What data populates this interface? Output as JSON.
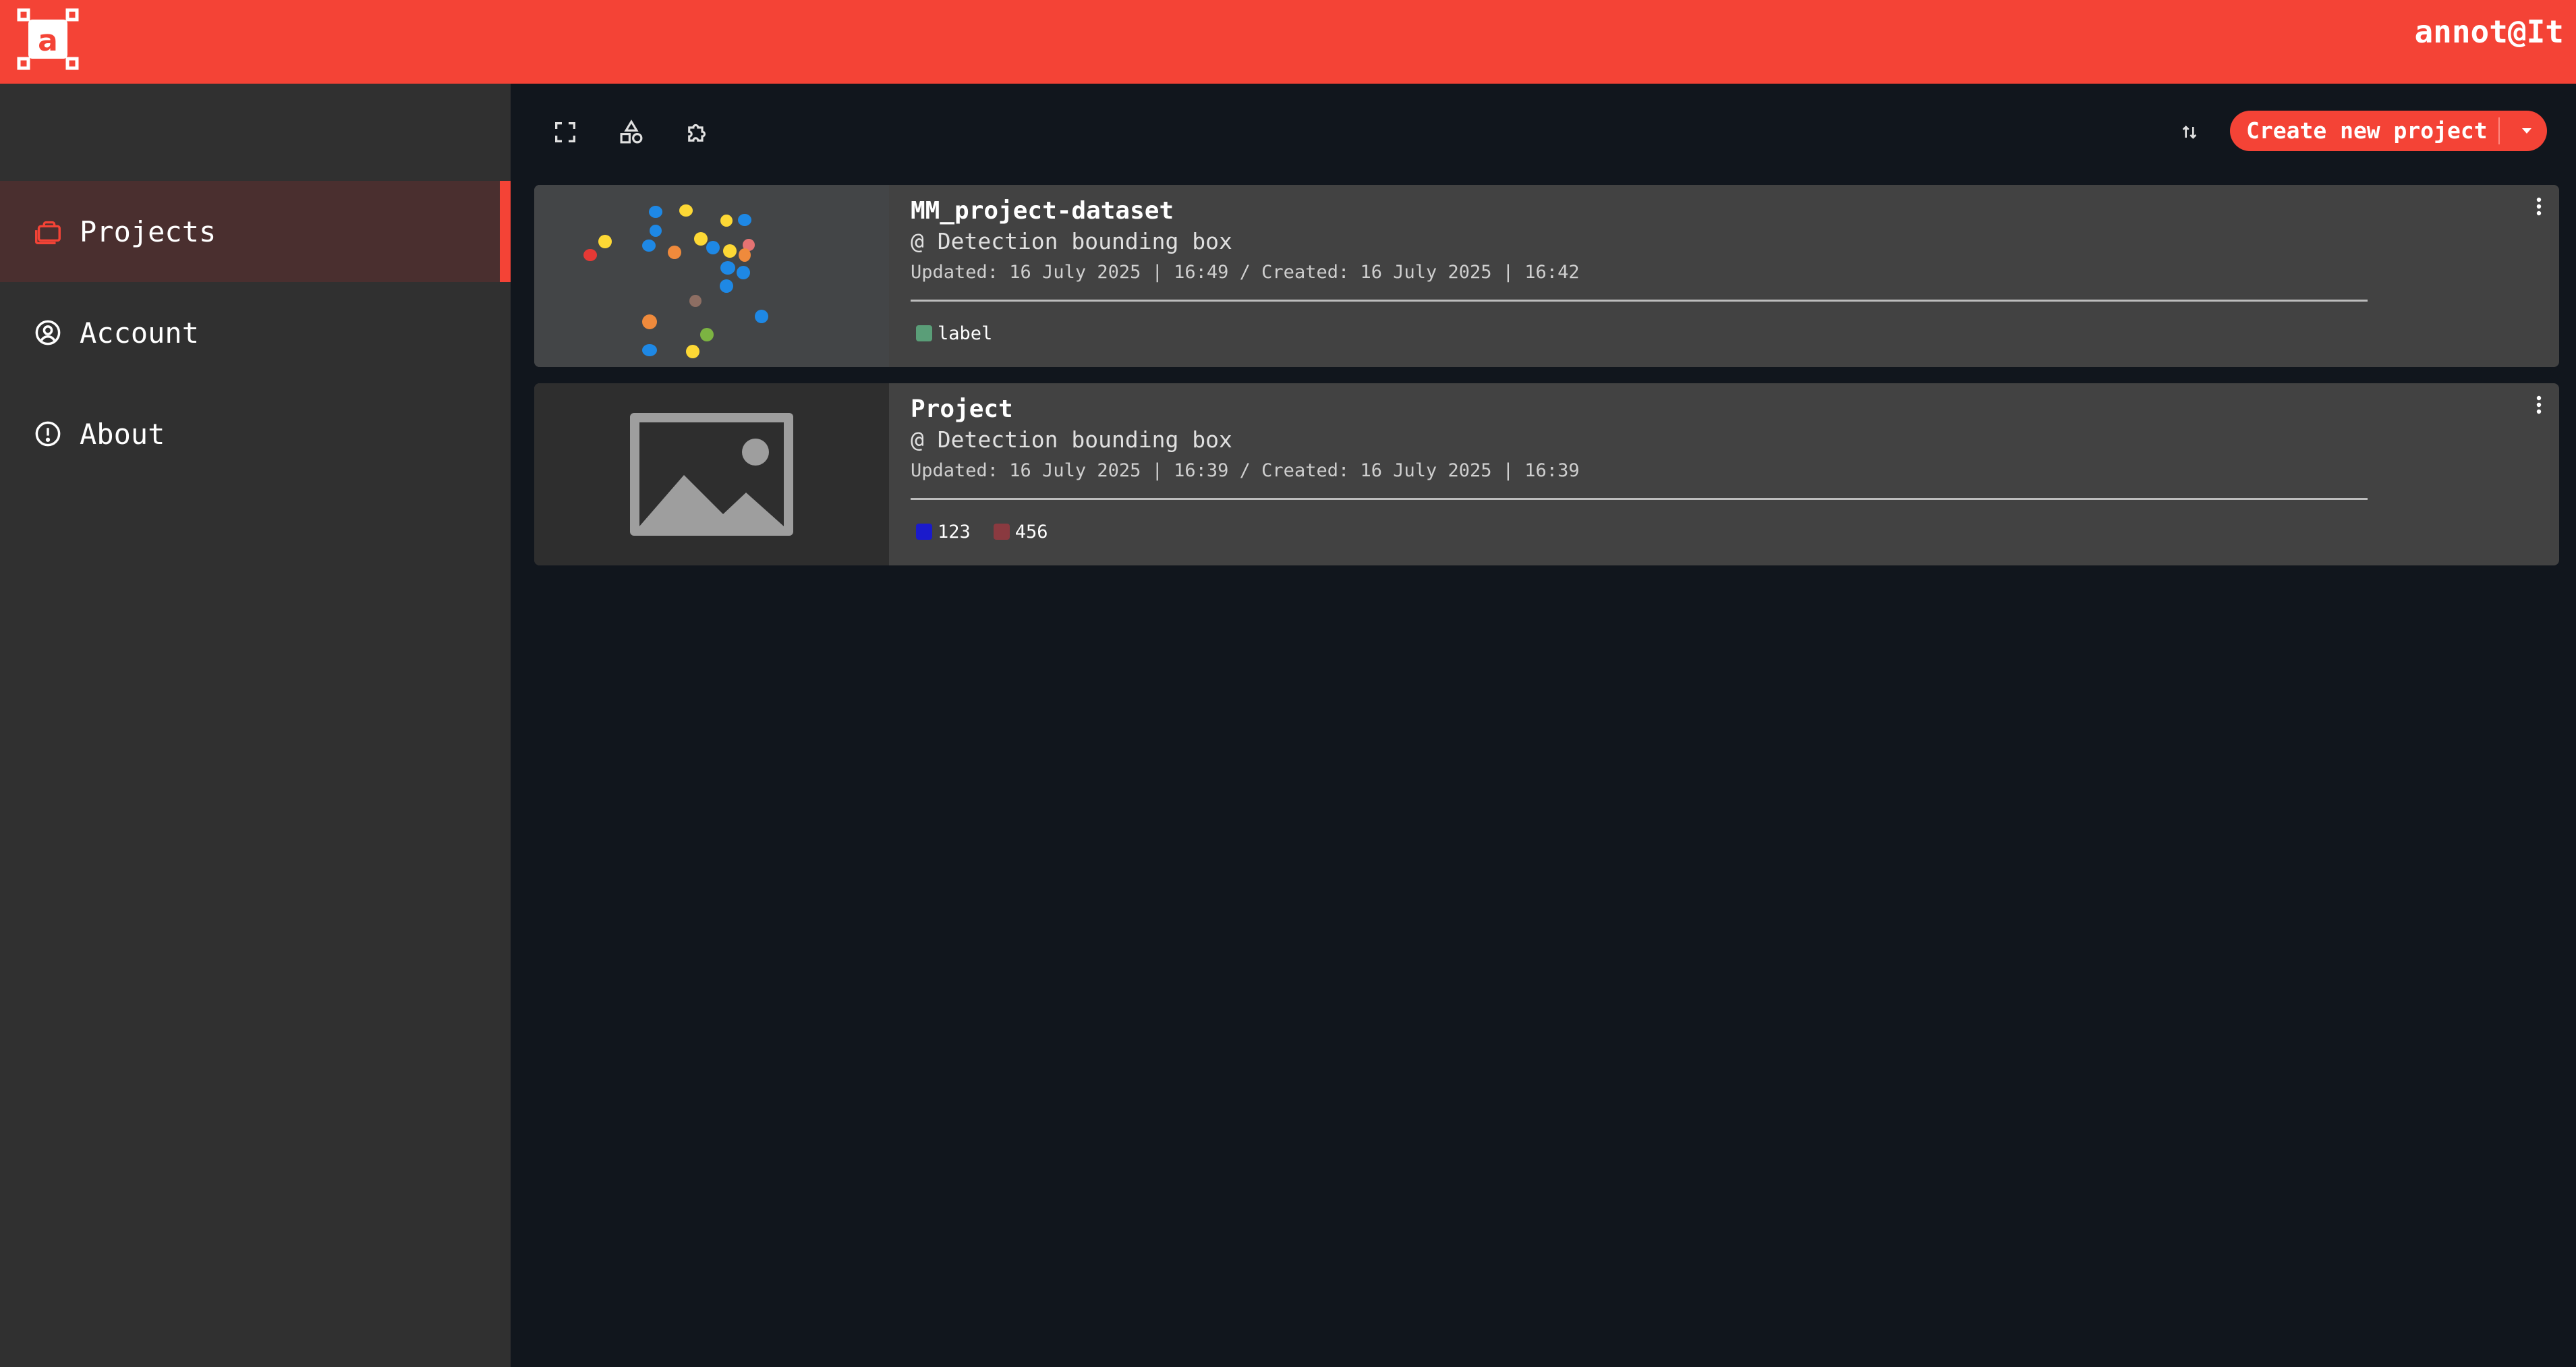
{
  "app": {
    "brand": "annot@It",
    "logo_letter": "a"
  },
  "sidebar": {
    "items": [
      {
        "label": "Projects",
        "icon": "briefcase-icon",
        "active": true
      },
      {
        "label": "Account",
        "icon": "account-circle-icon",
        "active": false
      },
      {
        "label": "About",
        "icon": "info-circle-icon",
        "active": false
      }
    ]
  },
  "toolbar": {
    "icons": [
      "fullscreen-icon",
      "shapes-icon",
      "puzzle-icon"
    ],
    "sort_icon": "sort-icon",
    "create_label": "Create new project",
    "create_dropdown_icon": "caret-down-icon"
  },
  "projects": [
    {
      "title": "MM_project-dataset",
      "type": "@ Detection bounding box",
      "dates": "Updated: 16 July 2025 | 16:49 / Created: 16 July 2025 | 16:42",
      "thumbnail": "candy-photo",
      "labels": [
        {
          "name": "label",
          "color": "#5a9e78"
        }
      ]
    },
    {
      "title": "Project",
      "type": "@ Detection bounding box",
      "dates": "Updated: 16 July 2025 | 16:39 / Created: 16 July 2025 | 16:39",
      "thumbnail": "image-placeholder-icon",
      "labels": [
        {
          "name": "123",
          "color": "#1a1acc"
        },
        {
          "name": "456",
          "color": "#8a3a40"
        }
      ]
    }
  ],
  "colors": {
    "accent": "#f44336",
    "background": "#11161d",
    "sidebar": "#303030",
    "card": "#424242"
  }
}
